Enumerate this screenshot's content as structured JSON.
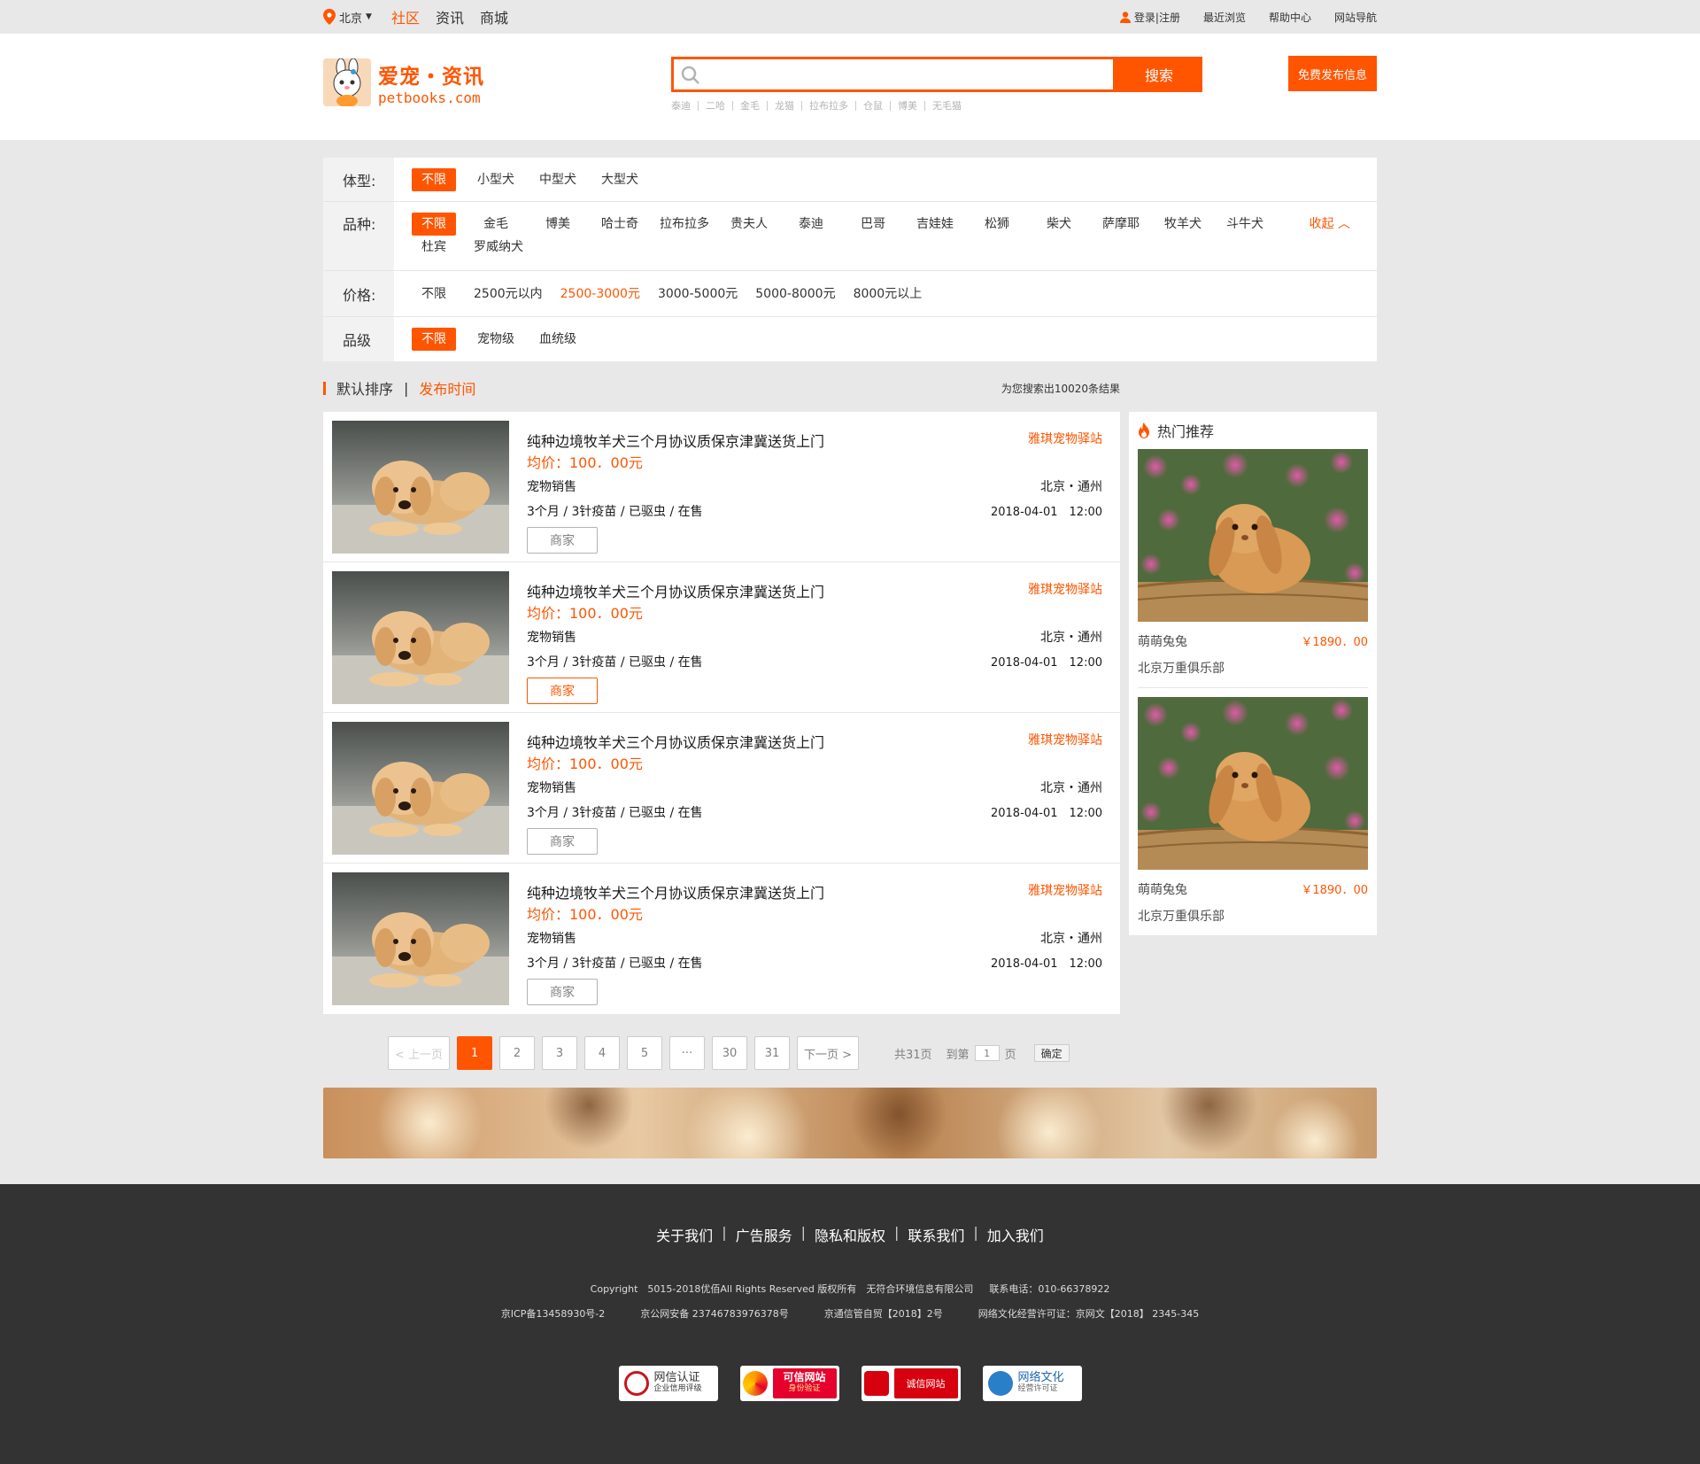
{
  "topbar": {
    "city": "北京",
    "nav": [
      "社区",
      "资讯",
      "商城"
    ],
    "login": "登录|注册",
    "recent": "最近浏览",
    "help": "帮助中心",
    "sitenav": "网站导航"
  },
  "header": {
    "logo_cn": "爱宠・资讯",
    "logo_en": "petbooks.com",
    "search_placeholder": "",
    "search_button": "搜索",
    "hot_words": [
      "泰迪",
      "二哈",
      "金毛",
      "龙猫",
      "拉布拉多",
      "仓鼠",
      "博美",
      "无毛猫"
    ],
    "publish_button": "免费发布信息"
  },
  "filters": {
    "size": {
      "label": "体型:",
      "options": [
        "不限",
        "小型犬",
        "中型犬",
        "大型犬"
      ]
    },
    "breed": {
      "label": "品种:",
      "options": [
        "不限",
        "金毛",
        "博美",
        "哈士奇",
        "拉布拉多",
        "贵夫人",
        "泰迪",
        "巴哥",
        "吉娃娃",
        "松狮",
        "柴犬",
        "萨摩耶",
        "牧羊犬",
        "斗牛犬",
        "杜宾",
        "罗威纳犬"
      ],
      "fold": "收起"
    },
    "price": {
      "label": "价格:",
      "options": [
        "不限",
        "2500元以内",
        "2500-3000元",
        "3000-5000元",
        "5000-8000元",
        "8000元以上"
      ]
    },
    "grade": {
      "label": "品级",
      "options": [
        "不限",
        "宠物级",
        "血统级"
      ]
    }
  },
  "sort": {
    "default": "默认排序",
    "sep": "|",
    "time": "发布时间",
    "result": "为您搜索出10020条结果"
  },
  "listings": [
    {
      "title": "纯种边境牧羊犬三个月协议质保京津冀送货上门",
      "price": "均价：100．00元",
      "seller": "宠物销售",
      "tags": "3个月 / 3针疫苗 / 已驱虫 / 在售",
      "button": "商家",
      "station": "雅琪宠物驿站",
      "location": "北京・通州",
      "date": "2018-04-01　12:00"
    },
    {
      "title": "纯种边境牧羊犬三个月协议质保京津冀送货上门",
      "price": "均价：100．00元",
      "seller": "宠物销售",
      "tags": "3个月 / 3针疫苗 / 已驱虫 / 在售",
      "button": "商家",
      "station": "雅琪宠物驿站",
      "location": "北京・通州",
      "date": "2018-04-01　12:00"
    },
    {
      "title": "纯种边境牧羊犬三个月协议质保京津冀送货上门",
      "price": "均价：100．00元",
      "seller": "宠物销售",
      "tags": "3个月 / 3针疫苗 / 已驱虫 / 在售",
      "button": "商家",
      "station": "雅琪宠物驿站",
      "location": "北京・通州",
      "date": "2018-04-01　12:00"
    },
    {
      "title": "纯种边境牧羊犬三个月协议质保京津冀送货上门",
      "price": "均价：100．00元",
      "seller": "宠物销售",
      "tags": "3个月 / 3针疫苗 / 已驱虫 / 在售",
      "button": "商家",
      "station": "雅琪宠物驿站",
      "location": "北京・通州",
      "date": "2018-04-01　12:00"
    }
  ],
  "sidebar": {
    "title": "热门推荐",
    "items": [
      {
        "name": "萌萌兔兔",
        "price": "￥1890．00",
        "club": "北京万重俱乐部"
      },
      {
        "name": "萌萌兔兔",
        "price": "￥1890．00",
        "club": "北京万重俱乐部"
      }
    ]
  },
  "pager": {
    "prev": "< 上一页",
    "pages": [
      "1",
      "2",
      "3",
      "4",
      "5",
      "···",
      "30",
      "31"
    ],
    "next": "下一页 >",
    "total": "共31页",
    "goto": "到第",
    "goto_value": "1",
    "page_unit": "页",
    "ok": "确定"
  },
  "footer": {
    "links": [
      "关于我们",
      "广告服务",
      "隐私和版权",
      "联系我们",
      "加入我们"
    ],
    "copyright": "Copyright　5015-2018优佰All Rights Reserved 版权所有　无符合环境信息有限公司",
    "phone": "联系电话：010-66378922",
    "icp": "京ICP备13458930号-2",
    "police": "京公网安备 23746783976378号",
    "telecom": "京通信管自贸【2018】2号",
    "culture": "网络文化经营许可证：京网文【2018】 2345-345",
    "badges": [
      {
        "main": "网信认证",
        "sub": "企业信用评级"
      },
      {
        "main": "可信网站",
        "sub": "身份验证"
      },
      {
        "main": "诚信网站",
        "sub": ""
      },
      {
        "main": "网络文化",
        "sub": "经营许可证"
      }
    ]
  },
  "colors": {
    "accent": "#ff5500",
    "text": "#333333",
    "muted": "#808080",
    "filter_bg": "#f2f2f2",
    "footer_bg": "#333333"
  }
}
